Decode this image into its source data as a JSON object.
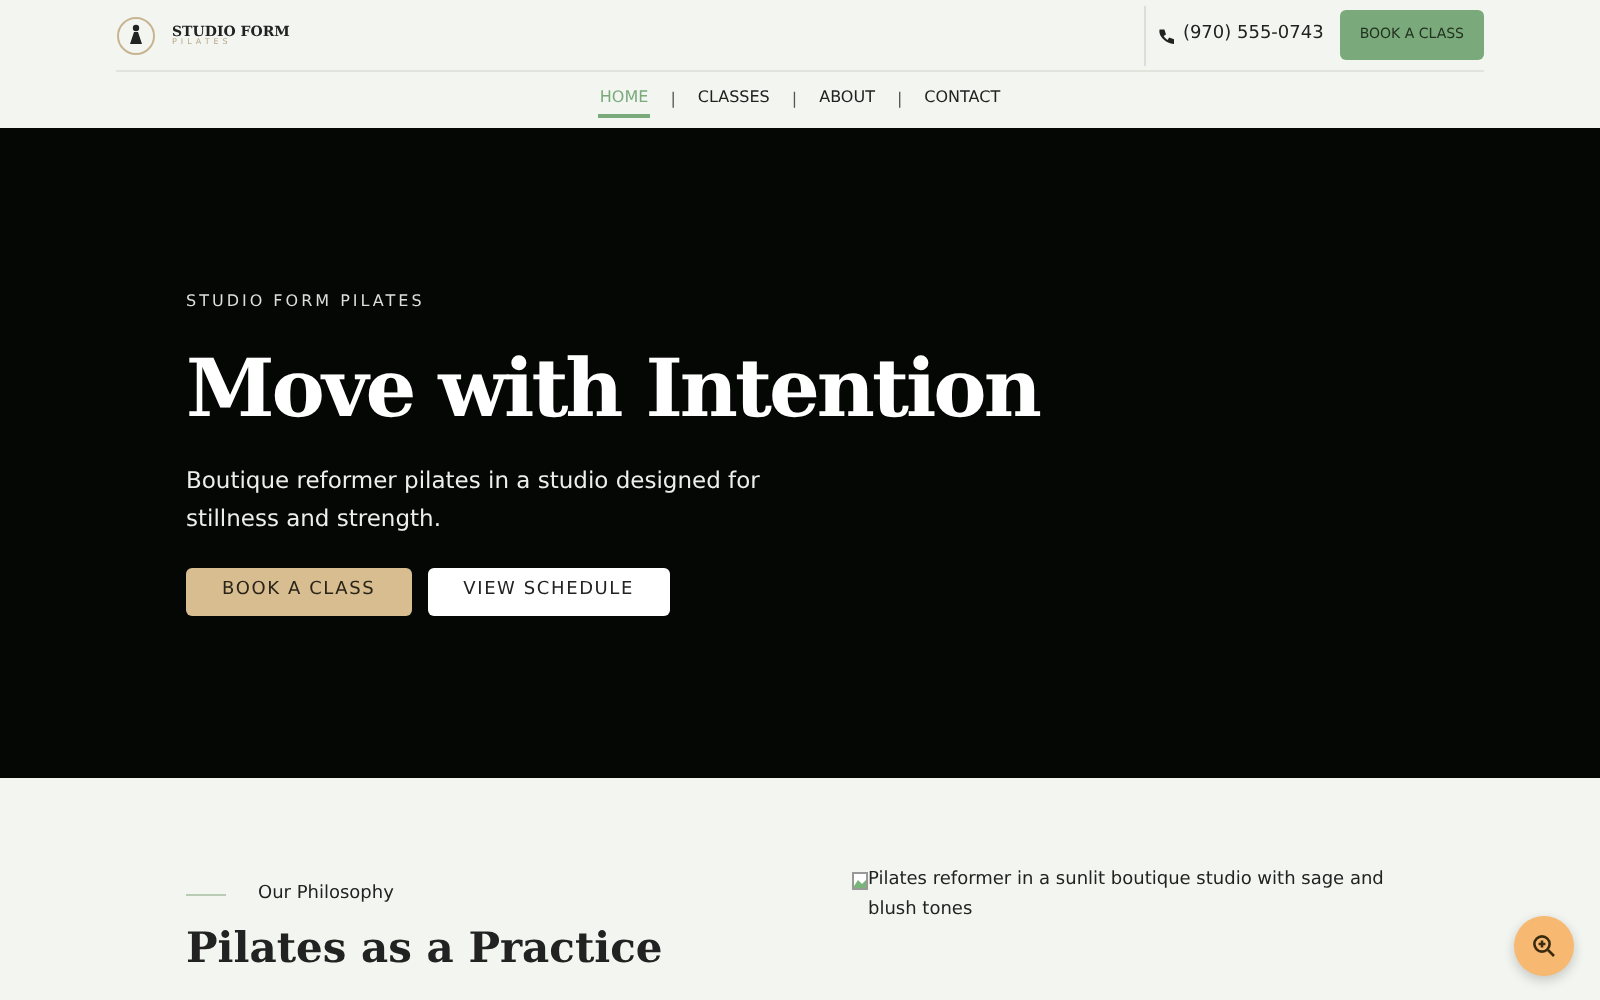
{
  "brand": {
    "name": "STUDIO FORM",
    "tagline": "PILATES"
  },
  "header": {
    "phone": "(970) 555-0743",
    "cta": "BOOK A CLASS"
  },
  "nav": [
    {
      "label": "HOME",
      "selected": true
    },
    {
      "label": "CLASSES",
      "selected": false
    },
    {
      "label": "ABOUT",
      "selected": false
    },
    {
      "label": "CONTACT",
      "selected": false
    }
  ],
  "nav_separator": "|",
  "hero": {
    "eyebrow": "STUDIO FORM PILATES",
    "title": "Move with Intention",
    "subtitle": "Boutique reformer pilates in a studio designed for stillness and strength.",
    "buttons": [
      {
        "label": "BOOK A CLASS",
        "kind": "primary"
      },
      {
        "label": "VIEW SCHEDULE",
        "kind": "secondary"
      }
    ]
  },
  "philosophy": {
    "eyebrow": "Our Philosophy",
    "title": "Pilates as a Practice",
    "image_alt": "Pilates reformer in a sunlit boutique studio with sage and blush tones"
  }
}
